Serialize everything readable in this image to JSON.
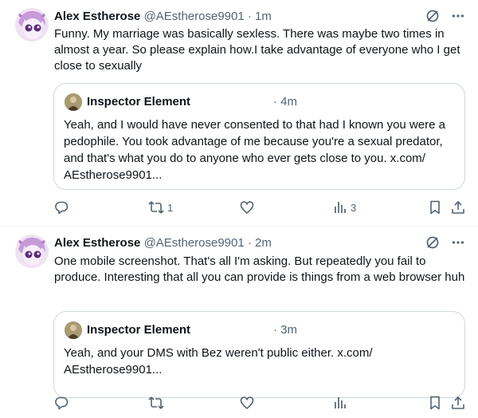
{
  "tweets": [
    {
      "author_name": "Alex Estherose",
      "handle": "@AEstherose9901",
      "separator": "·",
      "time": "1m",
      "text": "Funny. My marriage was basically sexless. There was maybe two times in almost a year. So please explain how.I take advantage of everyone who I get close to sexually",
      "quote": {
        "author_name": "Inspector Element",
        "time": "· 4m",
        "text_lines": [
          "Yeah, and I would have never consented to that had I known you were a",
          "pedophile. You took advantage of me because you're a sexual predator,",
          "and that's what you do to anyone who ever gets close to you. x.com/",
          "AEstherose9901..."
        ]
      },
      "actions": {
        "reposts": "1",
        "views": "3"
      }
    },
    {
      "author_name": "Alex Estherose",
      "handle": "@AEstherose9901",
      "separator": "·",
      "time": "2m",
      "text": "One mobile screenshot. That's all I'm asking. But repeatedly you fail to produce. Interesting that all you can provide is things from a web browser huh",
      "quote": {
        "author_name": "Inspector Element",
        "time": "· 3m",
        "text_lines": [
          "Yeah, and your DMS with Bez weren't public either. x.com/",
          "AEstherose9901..."
        ]
      },
      "actions": {
        "reposts": "",
        "views": ""
      }
    }
  ],
  "icons": {
    "grok": "grok-icon",
    "more": "more-icon",
    "reply": "reply-icon",
    "repost": "repost-icon",
    "like": "like-icon",
    "views": "views-icon",
    "bookmark": "bookmark-icon",
    "share": "share-icon"
  },
  "colors": {
    "text": "#0f1419",
    "secondary": "#536471",
    "border": "#cfd9de"
  }
}
